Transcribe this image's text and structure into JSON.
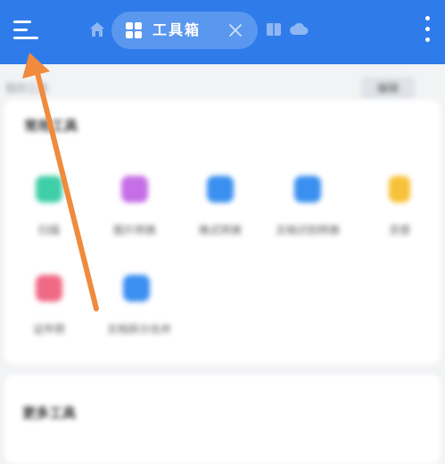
{
  "topbar": {
    "tab_label": "工具箱",
    "icons": [
      "menu-icon",
      "home-icon",
      "grid-icon",
      "close-icon",
      "book-icon",
      "cloud-icon",
      "more-vertical-icon"
    ]
  },
  "colors": {
    "topbar": "#2f7bea",
    "tab_pill": "#5a97ee",
    "arrow": "#f08a3c",
    "background": "#f2f3f5"
  },
  "section": {
    "small_title": "我的工具",
    "edit_label": "编辑"
  },
  "card": {
    "title": "常用工具",
    "tools": [
      {
        "label": "扫描",
        "color": "#3fcfa8"
      },
      {
        "label": "图片转换",
        "color": "#c66ee6"
      },
      {
        "label": "格式转换",
        "color": "#3a8ff0"
      },
      {
        "label": "文档识别转换",
        "color": "#3a8ff0"
      },
      {
        "label": "灵感",
        "color": "#f7c23a"
      },
      {
        "label": "证件照",
        "color": "#f06a86"
      },
      {
        "label": "文档拆分合并",
        "color": "#3a8ff0"
      }
    ]
  },
  "card2": {
    "title": "更多工具"
  }
}
